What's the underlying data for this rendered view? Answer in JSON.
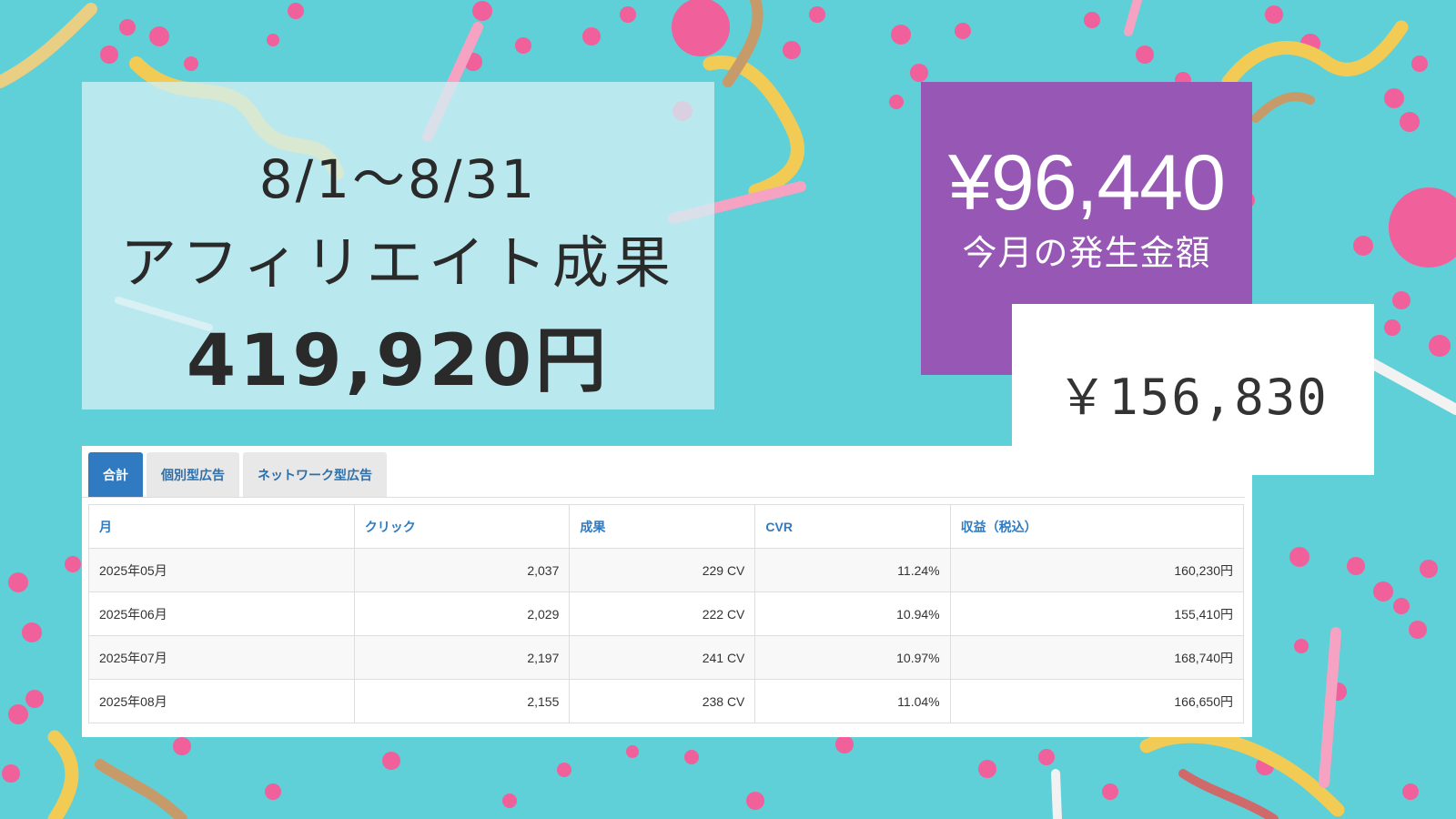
{
  "title_panel": {
    "range": "8/1～8/31",
    "subtitle": "アフィリエイト成果",
    "total": "419,920円"
  },
  "purple_panel": {
    "amount": "¥96,440",
    "label": "今月の発生金額"
  },
  "white_panel": {
    "amount": "￥156,830"
  },
  "tabs": [
    {
      "label": "合計",
      "active": true
    },
    {
      "label": "個別型広告",
      "active": false
    },
    {
      "label": "ネットワーク型広告",
      "active": false
    }
  ],
  "table": {
    "headers": [
      "月",
      "クリック",
      "成果",
      "CVR",
      "収益（税込）"
    ],
    "rows": [
      [
        "2025年05月",
        "2,037",
        "229 CV",
        "11.24%",
        "160,230円"
      ],
      [
        "2025年06月",
        "2,029",
        "222 CV",
        "10.94%",
        "155,410円"
      ],
      [
        "2025年07月",
        "2,197",
        "241 CV",
        "10.97%",
        "168,740円"
      ],
      [
        "2025年08月",
        "2,155",
        "238 CV",
        "11.04%",
        "166,650円"
      ]
    ]
  },
  "colors": {
    "background": "#5fcfd8",
    "purple": "#9757b5",
    "confetti": "#f0609a",
    "tab_active": "#2f7ac0"
  }
}
